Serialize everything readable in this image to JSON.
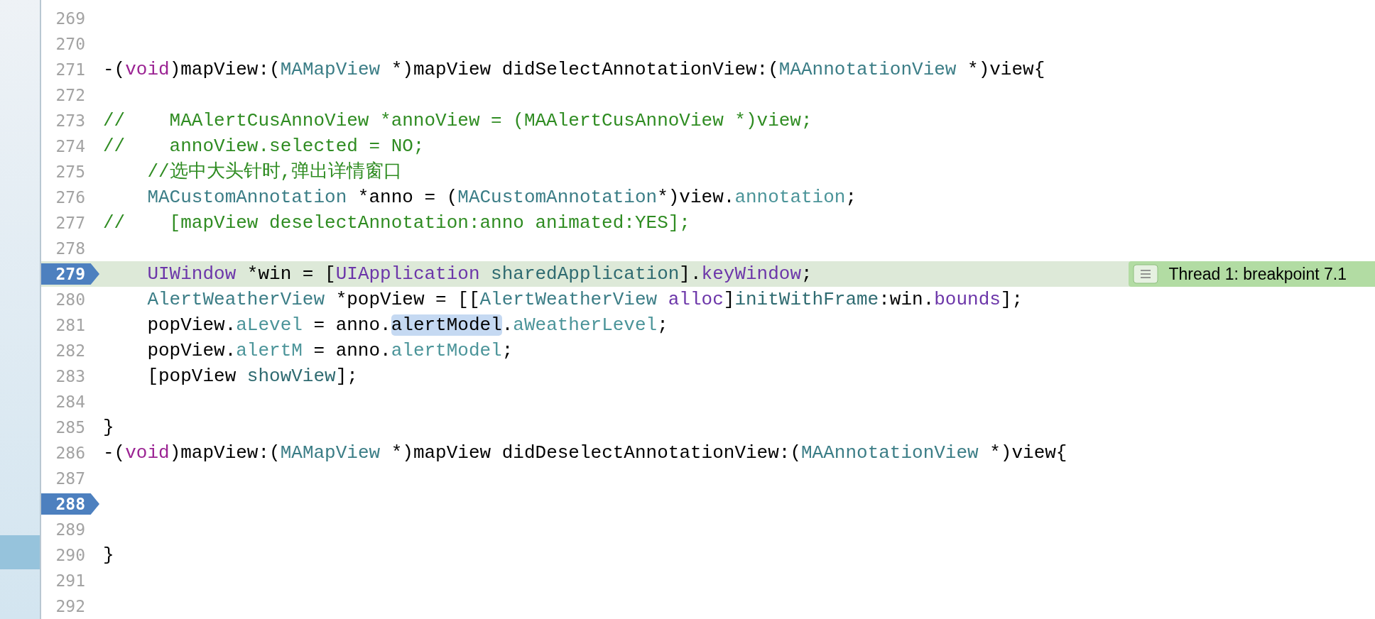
{
  "editor": {
    "lines": [
      {
        "number": "269",
        "breakpoint": false,
        "current": false
      },
      {
        "number": "270",
        "breakpoint": false,
        "current": false
      },
      {
        "number": "271",
        "breakpoint": false,
        "current": false,
        "tokens": [
          {
            "text": "-(",
            "kind": "plain"
          },
          {
            "text": "void",
            "kind": "keyword"
          },
          {
            "text": ")mapView:(",
            "kind": "plain"
          },
          {
            "text": "MAMapView",
            "kind": "type"
          },
          {
            "text": " *)mapView didSelectAnnotationView:(",
            "kind": "plain"
          },
          {
            "text": "MAAnnotationView",
            "kind": "type"
          },
          {
            "text": " *)view{",
            "kind": "plain"
          }
        ]
      },
      {
        "number": "272",
        "breakpoint": false,
        "current": false
      },
      {
        "number": "273",
        "breakpoint": false,
        "current": false,
        "tokens": [
          {
            "text": "//    MAAlertCusAnnoView *annoView = (MAAlertCusAnnoView *)view;",
            "kind": "comment"
          }
        ]
      },
      {
        "number": "274",
        "breakpoint": false,
        "current": false,
        "tokens": [
          {
            "text": "//    annoView.selected = NO;",
            "kind": "comment"
          }
        ]
      },
      {
        "number": "275",
        "breakpoint": false,
        "current": false,
        "tokens": [
          {
            "text": "    //选中大头针时,弹出详情窗口",
            "kind": "comment"
          }
        ]
      },
      {
        "number": "276",
        "breakpoint": false,
        "current": false,
        "tokens": [
          {
            "text": "    MACustomAnnotation",
            "kind": "type"
          },
          {
            "text": " *anno = (",
            "kind": "plain"
          },
          {
            "text": "MACustomAnnotation",
            "kind": "type"
          },
          {
            "text": "*)view.",
            "kind": "plain"
          },
          {
            "text": "annotation",
            "kind": "property"
          },
          {
            "text": ";",
            "kind": "plain"
          }
        ]
      },
      {
        "number": "277",
        "breakpoint": false,
        "current": false,
        "tokens": [
          {
            "text": "//    [mapView deselectAnnotation:anno animated:YES];",
            "kind": "comment"
          }
        ]
      },
      {
        "number": "278",
        "breakpoint": false,
        "current": false
      },
      {
        "number": "279",
        "breakpoint": true,
        "current": true,
        "tokens": [
          {
            "text": "    UIWindow",
            "kind": "system"
          },
          {
            "text": " *win = [",
            "kind": "plain"
          },
          {
            "text": "UIApplication ",
            "kind": "system"
          },
          {
            "text": "sharedApplication",
            "kind": "method"
          },
          {
            "text": "].",
            "kind": "plain"
          },
          {
            "text": "keyWindow",
            "kind": "system"
          },
          {
            "text": ";",
            "kind": "plain"
          }
        ],
        "annotation": "Thread 1: breakpoint 7.1"
      },
      {
        "number": "280",
        "breakpoint": false,
        "current": false,
        "tokens": [
          {
            "text": "    AlertWeatherView",
            "kind": "type"
          },
          {
            "text": " *popView = [[",
            "kind": "plain"
          },
          {
            "text": "AlertWeatherView ",
            "kind": "type"
          },
          {
            "text": "alloc",
            "kind": "system"
          },
          {
            "text": "]",
            "kind": "plain"
          },
          {
            "text": "initWithFrame",
            "kind": "method"
          },
          {
            "text": ":win.",
            "kind": "plain"
          },
          {
            "text": "bounds",
            "kind": "system"
          },
          {
            "text": "];",
            "kind": "plain"
          }
        ]
      },
      {
        "number": "281",
        "breakpoint": false,
        "current": false,
        "tokens": [
          {
            "text": "    popView.",
            "kind": "plain"
          },
          {
            "text": "aLevel",
            "kind": "property"
          },
          {
            "text": " = anno.",
            "kind": "plain"
          },
          {
            "text": "alertModel",
            "kind": "highlight"
          },
          {
            "text": ".",
            "kind": "plain"
          },
          {
            "text": "aWeatherLevel",
            "kind": "property"
          },
          {
            "text": ";",
            "kind": "plain"
          }
        ]
      },
      {
        "number": "282",
        "breakpoint": false,
        "current": false,
        "tokens": [
          {
            "text": "    popView.",
            "kind": "plain"
          },
          {
            "text": "alertM",
            "kind": "property"
          },
          {
            "text": " = anno.",
            "kind": "plain"
          },
          {
            "text": "alertModel",
            "kind": "property"
          },
          {
            "text": ";",
            "kind": "plain"
          }
        ]
      },
      {
        "number": "283",
        "breakpoint": false,
        "current": false,
        "tokens": [
          {
            "text": "    [popView ",
            "kind": "plain"
          },
          {
            "text": "showView",
            "kind": "method"
          },
          {
            "text": "];",
            "kind": "plain"
          }
        ]
      },
      {
        "number": "284",
        "breakpoint": false,
        "current": false
      },
      {
        "number": "285",
        "breakpoint": false,
        "current": false,
        "tokens": [
          {
            "text": "}",
            "kind": "plain"
          }
        ]
      },
      {
        "number": "286",
        "breakpoint": false,
        "current": false,
        "tokens": [
          {
            "text": "-(",
            "kind": "plain"
          },
          {
            "text": "void",
            "kind": "keyword"
          },
          {
            "text": ")mapView:(",
            "kind": "plain"
          },
          {
            "text": "MAMapView",
            "kind": "type"
          },
          {
            "text": " *)mapView didDeselectAnnotationView:(",
            "kind": "plain"
          },
          {
            "text": "MAAnnotationView",
            "kind": "type"
          },
          {
            "text": " *)view{",
            "kind": "plain"
          }
        ]
      },
      {
        "number": "287",
        "breakpoint": false,
        "current": false
      },
      {
        "number": "288",
        "breakpoint": true,
        "current": false
      },
      {
        "number": "289",
        "breakpoint": false,
        "current": false
      },
      {
        "number": "290",
        "breakpoint": false,
        "current": false,
        "tokens": [
          {
            "text": "}",
            "kind": "plain"
          }
        ]
      },
      {
        "number": "291",
        "breakpoint": false,
        "current": false
      },
      {
        "number": "292",
        "breakpoint": false,
        "current": false
      }
    ]
  }
}
